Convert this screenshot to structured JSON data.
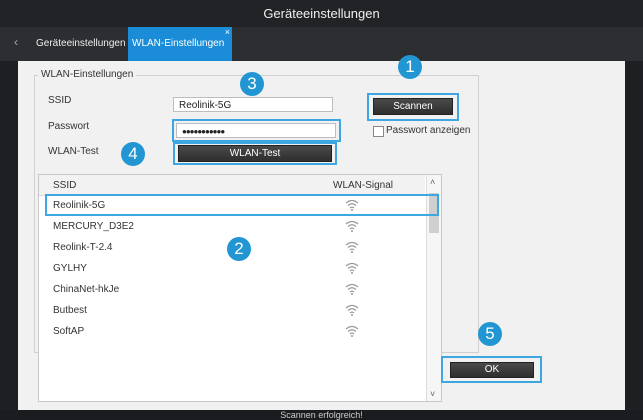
{
  "window": {
    "title": "Geräteeinstellungen"
  },
  "tabs": [
    {
      "label": "Geräteeinstellungen"
    },
    {
      "label": "WLAN-Einstellungen",
      "close": "×"
    }
  ],
  "group": {
    "title": "WLAN-Einstellungen"
  },
  "form": {
    "ssid_label": "SSID",
    "ssid_value": "Reolinik-5G",
    "password_label": "Passwort",
    "password_value": "●●●●●●●●●●●",
    "wlan_test_label": "WLAN-Test",
    "wlan_test_button": "WLAN-Test",
    "scan_button": "Scannen",
    "show_password_label": "Passwort anzeigen"
  },
  "list": {
    "col_ssid": "SSID",
    "col_signal": "WLAN-Signal",
    "rows": [
      {
        "ssid": "Reolinik-5G"
      },
      {
        "ssid": "MERCURY_D3E2"
      },
      {
        "ssid": "Reolink-T-2.4"
      },
      {
        "ssid": "GYLHY"
      },
      {
        "ssid": "ChinaNet-hkJe"
      },
      {
        "ssid": "Butbest"
      },
      {
        "ssid": "SoftAP"
      }
    ]
  },
  "ok_button": "OK",
  "callouts": [
    "1",
    "2",
    "3",
    "4",
    "5"
  ],
  "status": "Scannen erfolgreich!",
  "colors": {
    "accent": "#1a8cd8",
    "highlight": "#3ea6e0",
    "callout": "#2196d3"
  },
  "icons": {
    "wifi": "wifi-signal-icon",
    "back": "chevron-left-icon",
    "scroll_up": "chevron-up-icon",
    "scroll_down": "chevron-down-icon"
  }
}
